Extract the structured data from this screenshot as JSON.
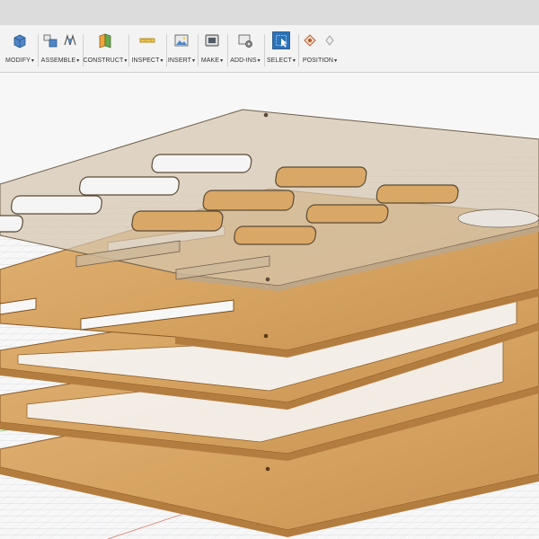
{
  "toolbar": {
    "groups": [
      {
        "label": "MODIFY"
      },
      {
        "label": "ASSEMBLE"
      },
      {
        "label": "CONSTRUCT"
      },
      {
        "label": "INSPECT"
      },
      {
        "label": "INSERT"
      },
      {
        "label": "MAKE"
      },
      {
        "label": "ADD-INS"
      },
      {
        "label": "SELECT"
      },
      {
        "label": "POSITION"
      }
    ],
    "caret": "▾"
  },
  "colors": {
    "wood": "#d9a867",
    "wood_edge": "#b07a3c",
    "acrylic": "#d4c4ad",
    "acrylic_edge": "#7d6d58",
    "grid": "#b9c0c7",
    "background": "#f7f7f7",
    "select_accent": "#2d73b8"
  }
}
